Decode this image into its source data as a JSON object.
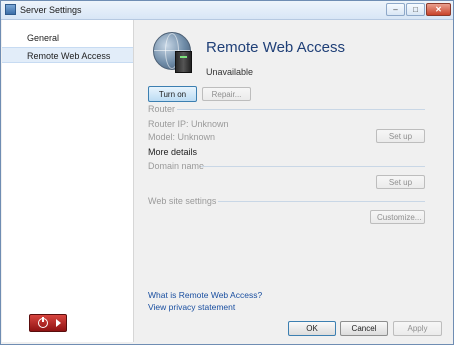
{
  "window": {
    "title": "Server Settings",
    "minimize_glyph": "–",
    "maximize_glyph": "□",
    "close_glyph": "✕"
  },
  "sidebar": {
    "items": [
      {
        "label": "General",
        "selected": false
      },
      {
        "label": "Remote Web Access",
        "selected": true
      }
    ],
    "power_icon": "power-icon"
  },
  "main": {
    "feature_icon": "globe-server-icon",
    "heading": "Remote Web Access",
    "status": "Unavailable",
    "turn_on_label": "Turn on",
    "repair_label": "Repair...",
    "router": {
      "section_label": "Router",
      "router_ip": "Router IP: Unknown",
      "model": "Model: Unknown",
      "setup_label": "Set up"
    },
    "more_details": "More details",
    "domain": {
      "section_label": "Domain name",
      "setup_label": "Set up"
    },
    "web": {
      "section_label": "Web site settings",
      "customize_label": "Customize..."
    },
    "links": {
      "what_is": "What is Remote Web Access?",
      "privacy": "View privacy statement"
    }
  },
  "footer": {
    "ok_label": "OK",
    "cancel_label": "Cancel",
    "apply_label": "Apply"
  },
  "colors": {
    "heading": "#1f3f77",
    "link": "#1a4fa0",
    "selected_nav": "#e2edf9",
    "power_button": "#b51f1f"
  }
}
